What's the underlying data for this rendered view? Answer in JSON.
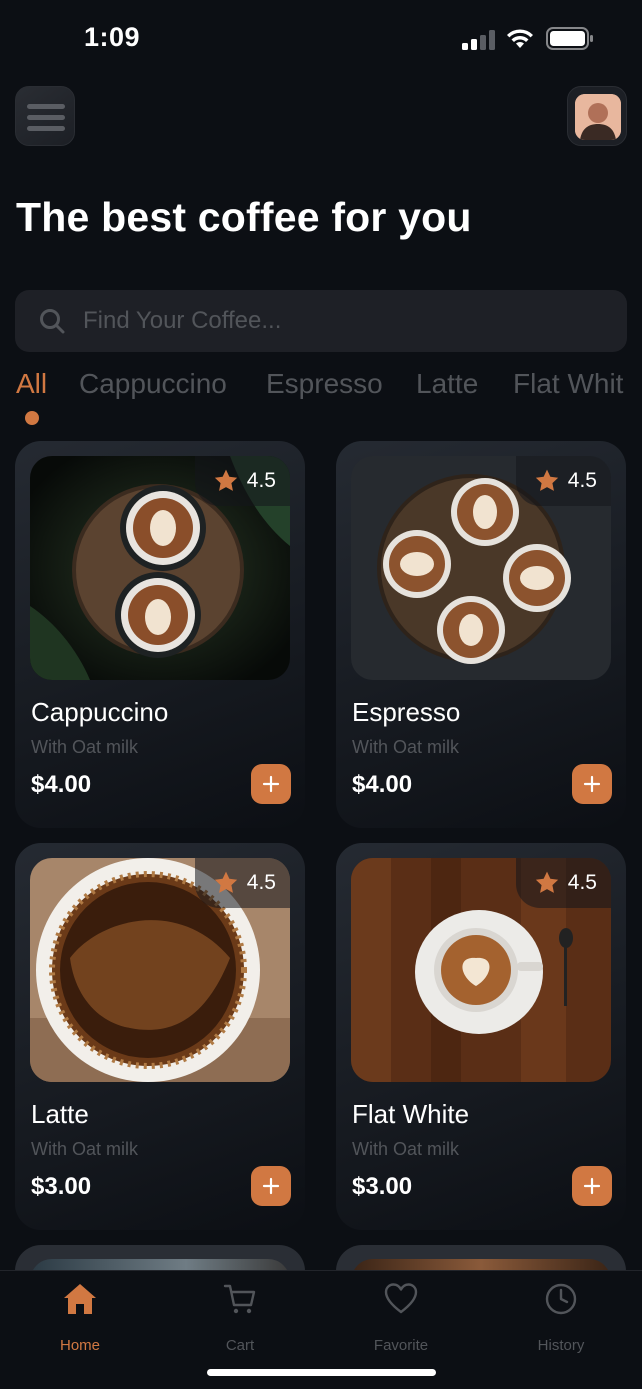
{
  "status_bar": {
    "time": "1:09"
  },
  "header": {
    "title": "The best coffee for you"
  },
  "search": {
    "placeholder": "Find Your Coffee..."
  },
  "categories": [
    "All",
    "Cappuccino",
    "Espresso",
    "Latte",
    "Flat Whit"
  ],
  "active_category": "All",
  "products": [
    {
      "name": "Cappuccino",
      "subtitle": "With Oat milk",
      "price": "$4.00",
      "rating": "4.5",
      "icon": "star-icon"
    },
    {
      "name": "Espresso",
      "subtitle": "With Oat milk",
      "price": "$4.00",
      "rating": "4.5",
      "icon": "star-icon"
    },
    {
      "name": "Latte",
      "subtitle": "With Oat milk",
      "price": "$3.00",
      "rating": "4.5",
      "icon": "star-icon"
    },
    {
      "name": "Flat White",
      "subtitle": "With Oat milk",
      "price": "$3.00",
      "rating": "4.5",
      "icon": "star-icon"
    }
  ],
  "bottom_nav": {
    "items": [
      {
        "label": "Home",
        "icon": "home-icon",
        "active": true
      },
      {
        "label": "Cart",
        "icon": "cart-icon",
        "active": false
      },
      {
        "label": "Favorite",
        "icon": "heart-icon",
        "active": false
      },
      {
        "label": "History",
        "icon": "clock-icon",
        "active": false
      }
    ]
  },
  "colors": {
    "accent": "#d17842",
    "background": "#0c0f14",
    "muted_text": "#52555a",
    "card": "#252a32"
  }
}
